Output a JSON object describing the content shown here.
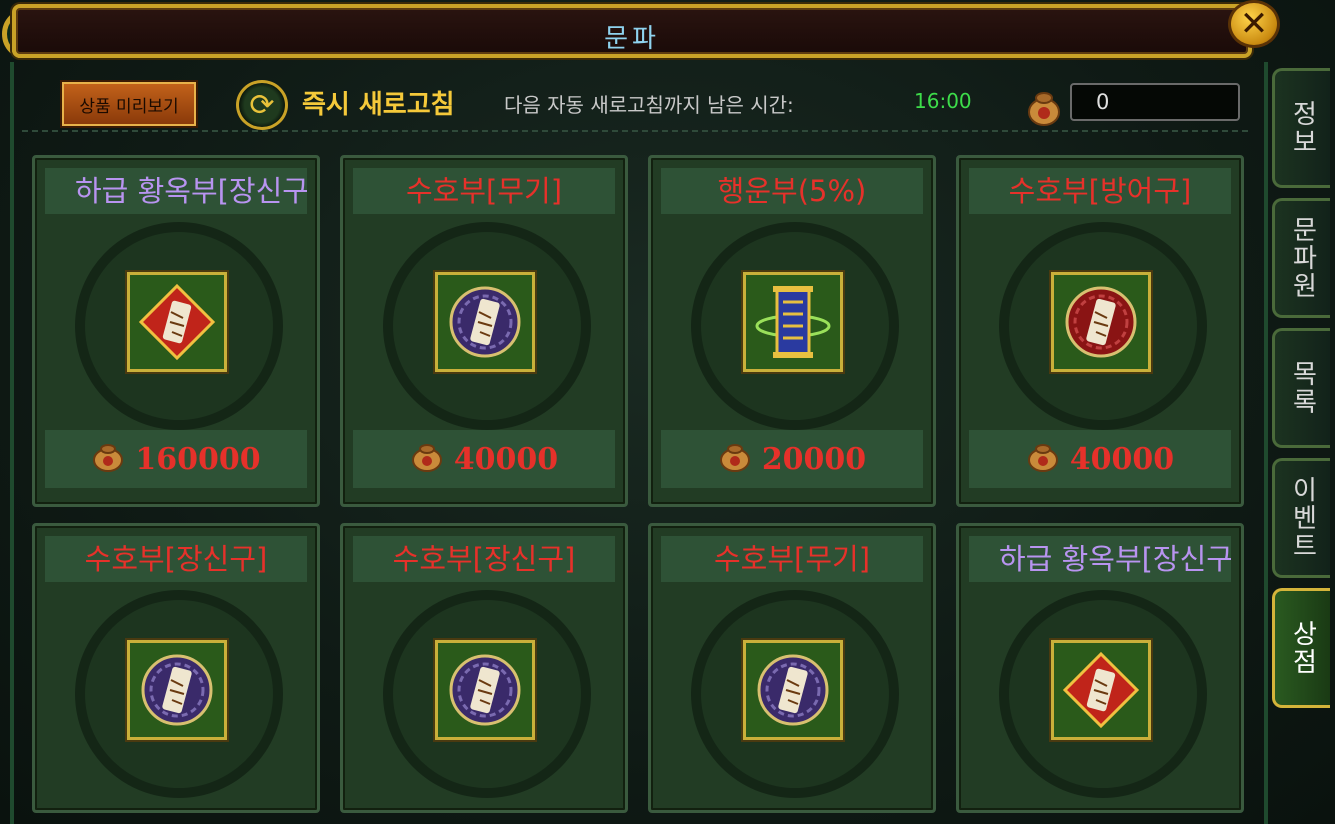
{
  "window": {
    "title": "문파",
    "close_label": "✕"
  },
  "toolbar": {
    "preview_label": "상품 미리보기",
    "refresh_label": "즉시 새로고침",
    "auto_refresh_label": "다음 자동 새로고침까지 남은 시간:",
    "timer": "16:00",
    "currency_value": "0"
  },
  "items": [
    {
      "name": "하급 황옥부[장신구]",
      "price": "160000",
      "name_color": "purple",
      "icon": "red-diamond-talisman-icon"
    },
    {
      "name": "수호부[무기]",
      "price": "40000",
      "name_color": "red",
      "icon": "purple-round-talisman-icon"
    },
    {
      "name": "행운부(5%)",
      "price": "20000",
      "name_color": "red",
      "icon": "blue-scroll-talisman-icon"
    },
    {
      "name": "수호부[방어구]",
      "price": "40000",
      "name_color": "red",
      "icon": "red-round-talisman-icon"
    },
    {
      "name": "수호부[장신구]",
      "price": "",
      "name_color": "red",
      "icon": "purple-round-talisman-icon"
    },
    {
      "name": "수호부[장신구]",
      "price": "",
      "name_color": "red",
      "icon": "purple-round-talisman-icon"
    },
    {
      "name": "수호부[무기]",
      "price": "",
      "name_color": "red",
      "icon": "purple-round-talisman-icon"
    },
    {
      "name": "하급 황옥부[장신구]",
      "price": "",
      "name_color": "purple",
      "icon": "red-diamond-talisman-icon"
    }
  ],
  "tabs": [
    {
      "label": "정보",
      "active": false
    },
    {
      "label": "문파원",
      "active": false
    },
    {
      "label": "목록",
      "active": false
    },
    {
      "label": "이벤트",
      "active": false
    },
    {
      "label": "상점",
      "active": true
    }
  ],
  "colors": {
    "price": "#e6312a",
    "name_red": "#e6312a",
    "name_purple": "#b894f0",
    "timer": "#3ddc4a",
    "gold": "#c9a227"
  }
}
